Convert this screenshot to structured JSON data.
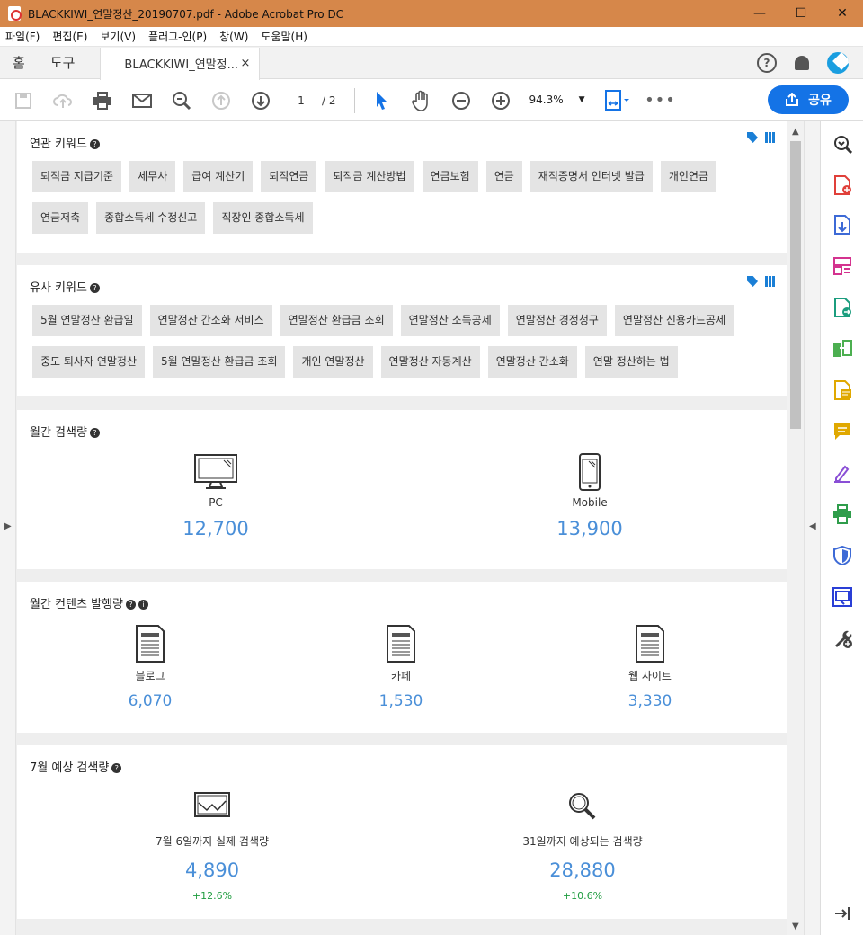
{
  "window": {
    "title": "BLACKKIWI_연말정산_20190707.pdf - Adobe Acrobat Pro DC",
    "minimize": "—",
    "maximize": "☐",
    "close": "✕"
  },
  "menu": [
    "파일(F)",
    "편집(E)",
    "보기(V)",
    "플러그-인(P)",
    "창(W)",
    "도움말(H)"
  ],
  "tabs": {
    "home": "홈",
    "tools": "도구",
    "doc": "BLACKKIWI_연말정...",
    "close": "×"
  },
  "toolbar": {
    "page_current": "1",
    "page_total": "/ 2",
    "zoom": "94.3%",
    "share": "공유"
  },
  "sections": {
    "related": {
      "title": "연관 키워드",
      "tags": [
        "퇴직금 지급기준",
        "세무사",
        "급여 계산기",
        "퇴직연금",
        "퇴직금 계산방법",
        "연금보험",
        "연금",
        "재직증명서 인터넷 발급",
        "개인연금",
        "연금저축",
        "종합소득세 수정신고",
        "직장인 종합소득세"
      ]
    },
    "similar": {
      "title": "유사 키워드",
      "tags": [
        "5월 연말정산 환급일",
        "연말정산 간소화 서비스",
        "연말정산 환급금 조회",
        "연말정산 소득공제",
        "연말정산 경정청구",
        "연말정산 신용카드공제",
        "중도 퇴사자 연말정산",
        "5월 연말정산 환급금 조회",
        "개인 연말정산",
        "연말정산 자동계산",
        "연말정산 간소화",
        "연말 정산하는 법"
      ]
    },
    "monthly": {
      "title": "월간 검색량",
      "pc_label": "PC",
      "pc_value": "12,700",
      "mobile_label": "Mobile",
      "mobile_value": "13,900"
    },
    "content": {
      "title": "월간 컨텐츠 발행량",
      "blog_label": "블로그",
      "blog_value": "6,070",
      "cafe_label": "카페",
      "cafe_value": "1,530",
      "web_label": "웹 사이트",
      "web_value": "3,330"
    },
    "forecast": {
      "title": "7월 예상 검색량",
      "actual_label": "7월 6일까지 실제 검색량",
      "actual_value": "4,890",
      "actual_change": "+12.6%",
      "expected_label": "31일까지 예상되는 검색량",
      "expected_value": "28,880",
      "expected_change": "+10.6%"
    }
  }
}
